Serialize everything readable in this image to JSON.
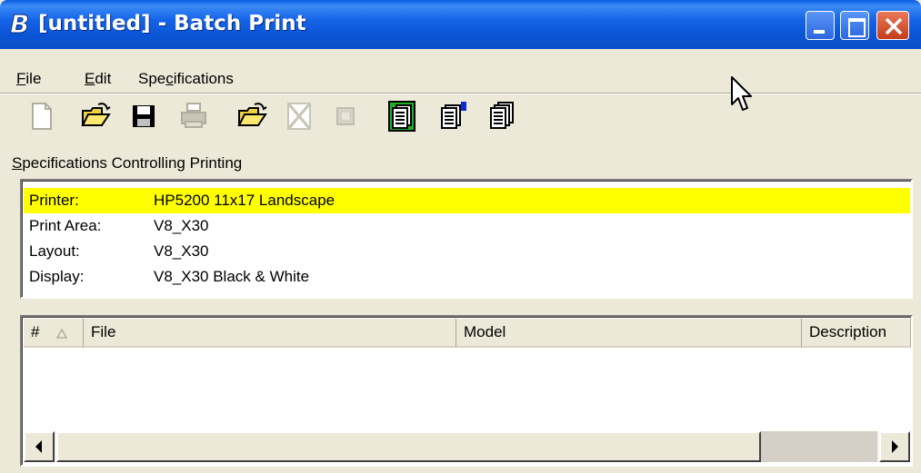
{
  "window": {
    "title": "[untitled] - Batch Print"
  },
  "menu": {
    "items": [
      {
        "pre": "",
        "mnemonic": "F",
        "post": "ile"
      },
      {
        "pre": "",
        "mnemonic": "E",
        "post": "dit"
      },
      {
        "pre": "Spe",
        "mnemonic": "c",
        "post": "ifications"
      }
    ]
  },
  "toolbar": {
    "buttons": [
      {
        "icon": "new-document-icon",
        "enabled": false
      },
      {
        "icon": "open-folder-icon",
        "enabled": true
      },
      {
        "icon": "save-icon",
        "enabled": true
      },
      {
        "icon": "print-icon",
        "enabled": false
      },
      {
        "icon": "open-specification-icon",
        "enabled": true
      },
      {
        "icon": "delete-icon",
        "enabled": false
      },
      {
        "icon": "disabled-square-icon",
        "enabled": false
      },
      {
        "icon": "print-preview-icon",
        "enabled": true
      },
      {
        "icon": "properties-icon",
        "enabled": true
      },
      {
        "icon": "print-multiple-icon",
        "enabled": true
      }
    ]
  },
  "specifications": {
    "label_pre": "",
    "label_mnemonic": "S",
    "label_post": "pecifications Controlling Printing",
    "rows": [
      {
        "key": "Printer:",
        "value": "HP5200 11x17 Landscape",
        "selected": true
      },
      {
        "key": "Print Area:",
        "value": "V8_X30",
        "selected": false
      },
      {
        "key": "Layout:",
        "value": "V8_X30",
        "selected": false
      },
      {
        "key": "Display:",
        "value": "V8_X30 Black & White",
        "selected": false
      }
    ]
  },
  "file_list": {
    "columns": [
      "#",
      "File",
      "Model",
      "Description"
    ],
    "rows": []
  },
  "colors": {
    "selection": "#ffff00",
    "titlebar": "#0a55d6"
  }
}
